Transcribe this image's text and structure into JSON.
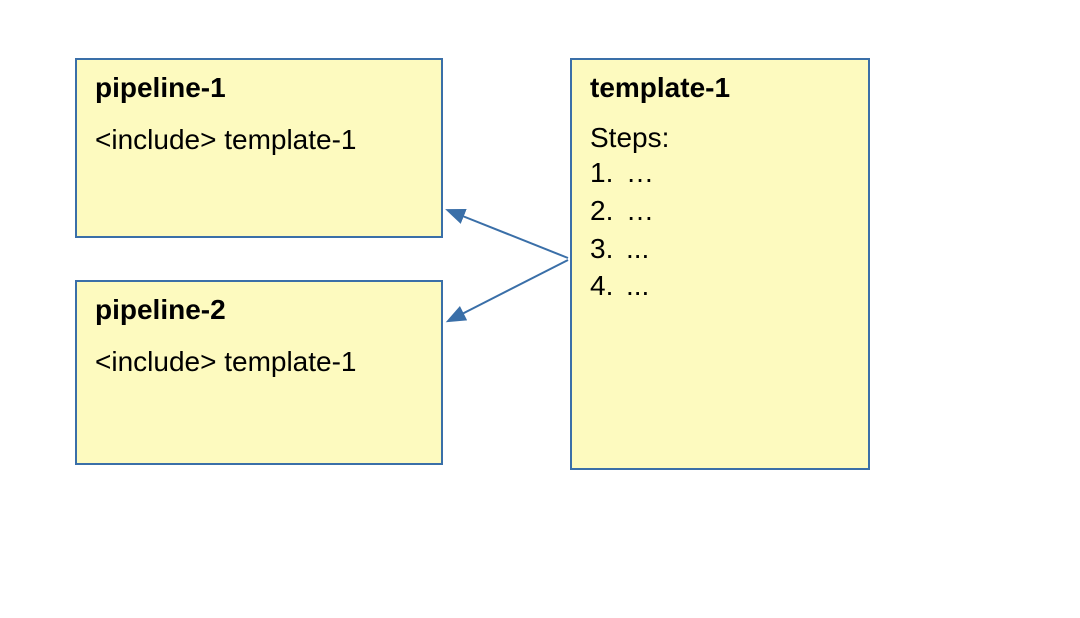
{
  "colors": {
    "box_bg": "#fdfabf",
    "box_border": "#3a6fa8",
    "arrow": "#3a6fa8"
  },
  "pipeline1": {
    "title": "pipeline-1",
    "body": "<include> template-1"
  },
  "pipeline2": {
    "title": "pipeline-2",
    "body": "<include> template-1"
  },
  "template1": {
    "title": "template-1",
    "steps_label": "Steps:",
    "steps": [
      {
        "num": "1.",
        "text": "…"
      },
      {
        "num": "2.",
        "text": "…"
      },
      {
        "num": "3.",
        "text": "..."
      },
      {
        "num": "4.",
        "text": "..."
      }
    ]
  }
}
